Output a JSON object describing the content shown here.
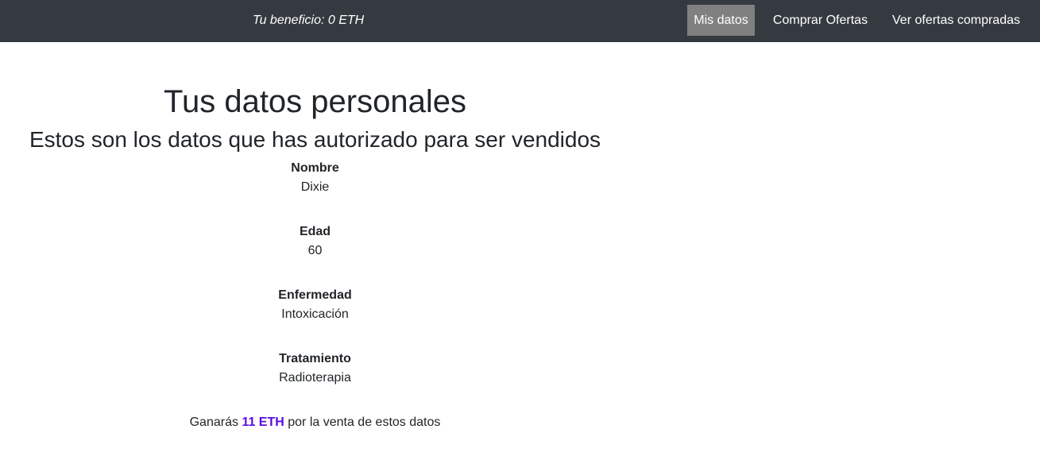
{
  "navbar": {
    "benefit": "Tu beneficio: 0 ETH",
    "items": [
      {
        "label": "Mis datos",
        "active": true
      },
      {
        "label": "Comprar Ofertas",
        "active": false
      },
      {
        "label": "Ver ofertas compradas",
        "active": false
      }
    ]
  },
  "main": {
    "title": "Tus datos personales",
    "subtitle": "Estos son los datos que has autorizado para ser vendidos",
    "fields": [
      {
        "label": "Nombre",
        "value": "Dixie"
      },
      {
        "label": "Edad",
        "value": "60"
      },
      {
        "label": "Enfermedad",
        "value": "Intoxicación"
      },
      {
        "label": "Tratamiento",
        "value": "Radioterapia"
      }
    ],
    "earnings": {
      "prefix": "Ganarás",
      "amount": "11 ETH",
      "suffix": "por la venta de estos datos"
    }
  },
  "colors": {
    "navbar_bg": "#343a40",
    "active_nav_bg": "#808080",
    "accent": "#5b0be0",
    "text": "#212529"
  }
}
